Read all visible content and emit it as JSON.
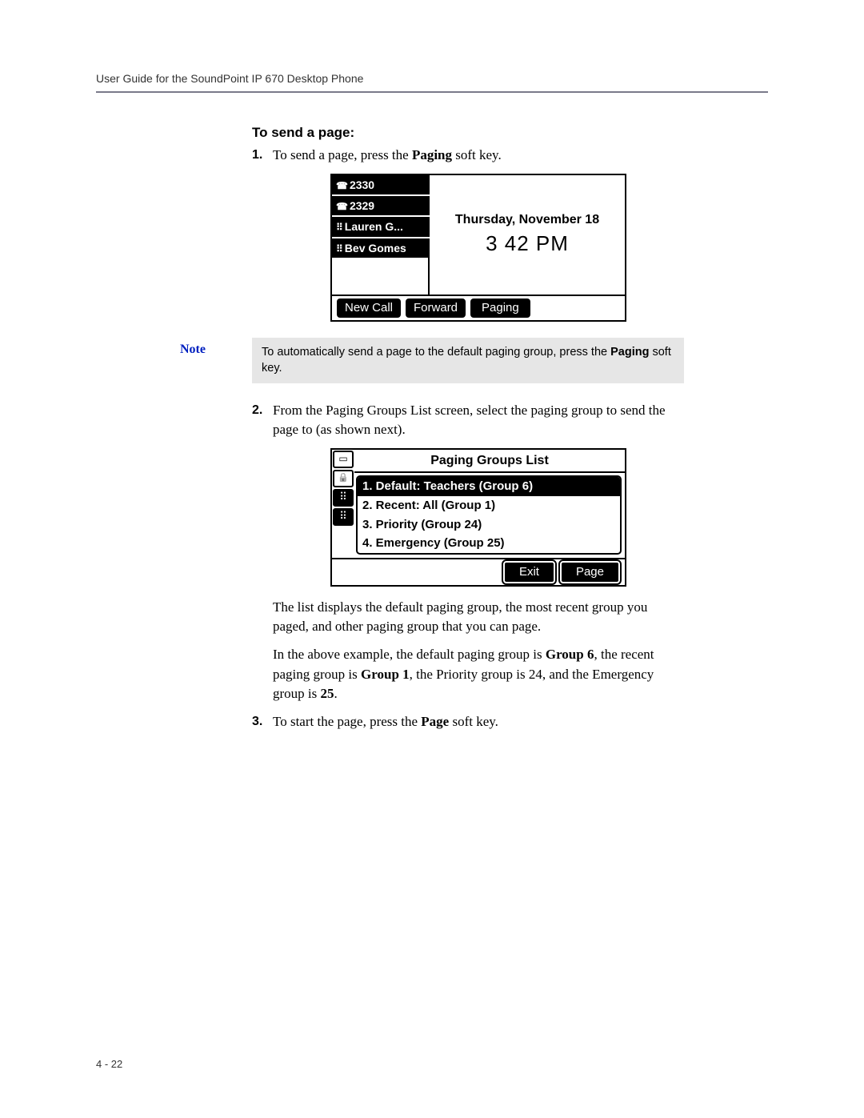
{
  "header": "User Guide for the SoundPoint IP 670 Desktop Phone",
  "section_title": "To send a page:",
  "step1_pre": "To send a page, press the ",
  "step1_bold": "Paging",
  "step1_post": " soft key.",
  "lcd1": {
    "lines": [
      "2330",
      "2329",
      "Lauren G...",
      "Bev Gomes"
    ],
    "date": "Thursday, November 18",
    "time": "3 42 PM",
    "soft": [
      "New Call",
      "Forward",
      "Paging"
    ]
  },
  "note": {
    "label": "Note",
    "text_pre": "To automatically send a page to the default paging group, press the ",
    "text_bold": "Paging",
    "text_post": " soft key."
  },
  "step2": "From the Paging Groups List screen, select the paging group to send the page to (as shown next).",
  "lcd2": {
    "title": "Paging Groups List",
    "items": [
      "1. Default: Teachers (Group 6)",
      "2. Recent: All (Group 1)",
      "3. Priority (Group 24)",
      "4. Emergency (Group 25)"
    ],
    "soft": [
      "Exit",
      "Page"
    ]
  },
  "para_after_lcd2": "The list displays the default paging group, the most recent group you paged, and other paging group that you can page.",
  "para_example": {
    "t1": "In the above example, the default paging group is ",
    "b1": "Group 6",
    "t2": ", the recent paging group is ",
    "b2": "Group 1",
    "t3": ", the Priority group is 24, and the Emergency group is ",
    "b3": "25",
    "t4": "."
  },
  "step3_pre": "To start the page, press the ",
  "step3_bold": "Page",
  "step3_post": " soft key.",
  "footer": "4 - 22"
}
